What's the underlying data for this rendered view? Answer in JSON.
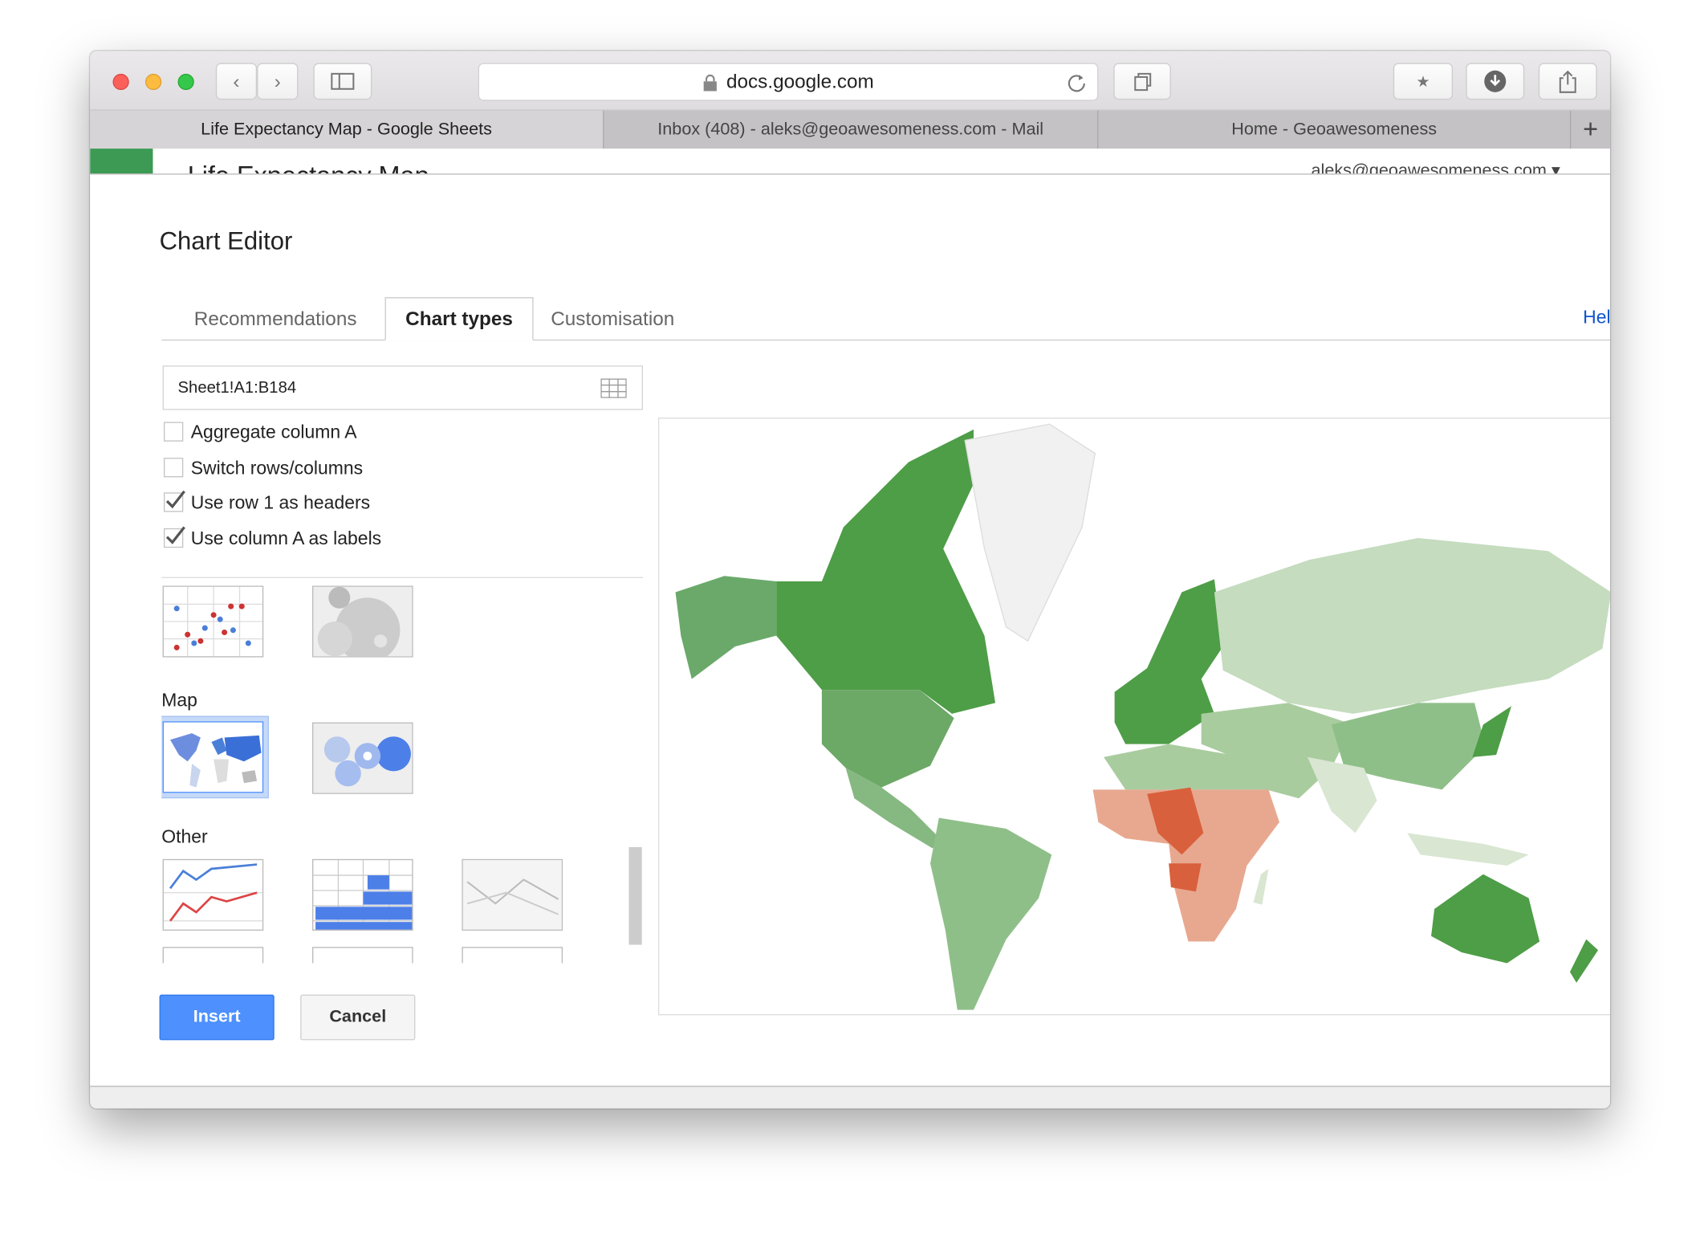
{
  "browser": {
    "url": "docs.google.com",
    "icons": [
      "close-light",
      "minimize-light",
      "zoom-light",
      "back-icon",
      "forward-icon",
      "sidebar-icon",
      "lock-icon",
      "reload-icon",
      "tabs-icon",
      "bookmark-icon",
      "download-icon",
      "share-icon",
      "new-tab-icon"
    ],
    "tabs": [
      {
        "label": "Life Expectancy Map - Google Sheets",
        "active": true
      },
      {
        "label": "Inbox (408) - aleks@geoawesomeness.com - Mail",
        "active": false
      },
      {
        "label": "Home - Geoawesomeness",
        "active": false
      }
    ],
    "new_tab": "+"
  },
  "sheets_header": {
    "title": "Life Expectancy Map",
    "account": "aleks@geoawesomeness.com ▾"
  },
  "dialog": {
    "title": "Chart Editor",
    "tabs": [
      {
        "label": "Recommendations"
      },
      {
        "label": "Chart types",
        "active": true
      },
      {
        "label": "Customisation"
      }
    ],
    "help": "Hel",
    "range": "Sheet1!A1:B184",
    "options": [
      {
        "label": "Aggregate column A",
        "checked": false
      },
      {
        "label": "Switch rows/columns",
        "checked": false
      },
      {
        "label": "Use row 1 as headers",
        "checked": true
      },
      {
        "label": "Use column A as labels",
        "checked": true
      }
    ],
    "sections": {
      "map": "Map",
      "other": "Other"
    },
    "selected_chart": "geo-chart",
    "insert": "Insert",
    "cancel": "Cancel"
  },
  "colors": {
    "accent": "#4d90fe",
    "map_high": "#4e9d47",
    "map_mid": "#8fbf89",
    "map_low_green": "#c5dcbf",
    "map_low": "#d9603c",
    "map_mid_red": "#e8a890",
    "no_data": "#f1f1f1"
  }
}
